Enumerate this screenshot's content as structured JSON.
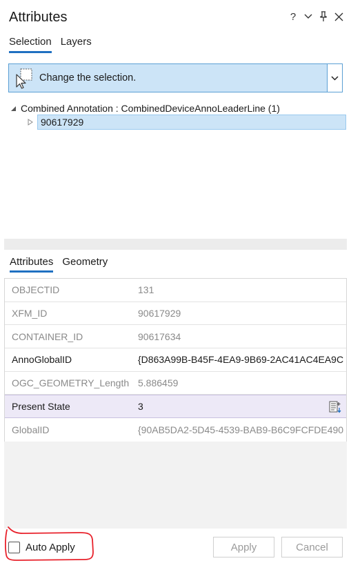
{
  "panel": {
    "title": "Attributes",
    "controls": {
      "help": "?",
      "menu": "⌄",
      "pin": "⊥",
      "close": "✕"
    }
  },
  "top_tabs": [
    {
      "label": "Selection",
      "active": true
    },
    {
      "label": "Layers",
      "active": false
    }
  ],
  "selection_tool": {
    "label": "Change the selection.",
    "icon": "select-cursor-icon",
    "dropdown_icon": "chevron-down-icon"
  },
  "tree": {
    "layer_label": "Combined Annotation : CombinedDeviceAnnoLeaderLine (1)",
    "features": [
      "90617929"
    ]
  },
  "bottom_tabs": [
    {
      "label": "Attributes",
      "active": true
    },
    {
      "label": "Geometry",
      "active": false
    }
  ],
  "attributes": [
    {
      "field": "OBJECTID",
      "value": "131"
    },
    {
      "field": "XFM_ID",
      "value": "90617929"
    },
    {
      "field": "CONTAINER_ID",
      "value": "90617634"
    },
    {
      "field": "AnnoGlobalID",
      "value": "{D863A99B-B45F-4EA9-9B69-2AC41AC4EA9C"
    },
    {
      "field": "OGC_GEOMETRY_Length",
      "value": "5.886459"
    },
    {
      "field": "Present State",
      "value": "3"
    },
    {
      "field": "GlobalID",
      "value": "{90AB5DA2-5D45-4539-BAB9-B6C9FCFDE490"
    }
  ],
  "footer": {
    "auto_apply_label": "Auto Apply",
    "auto_apply_checked": false,
    "apply_label": "Apply",
    "cancel_label": "Cancel"
  },
  "colors": {
    "accent": "#1f70c1",
    "selection_bg": "#cce4f7",
    "highlight_row": "#ede9f7",
    "annotation_red": "#e8202a"
  }
}
